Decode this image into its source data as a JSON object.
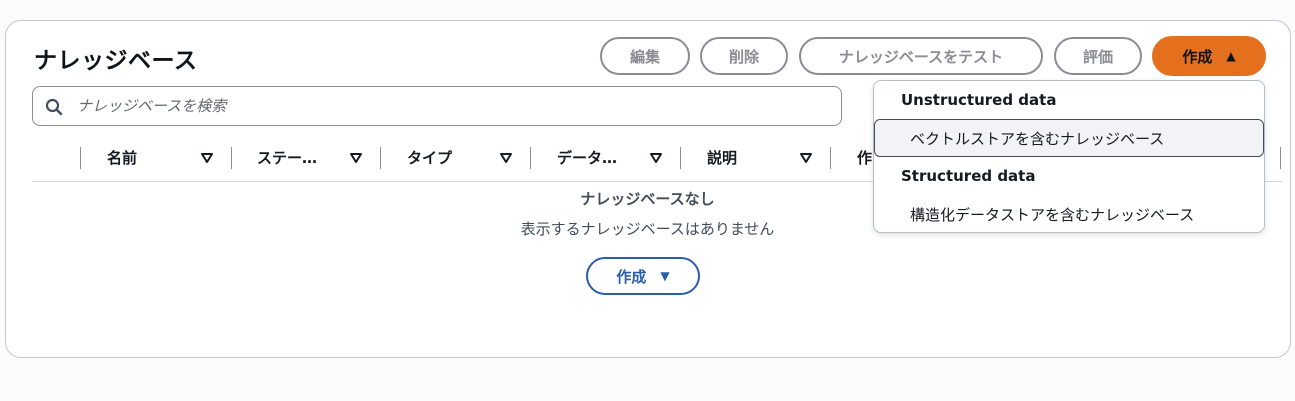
{
  "page": {
    "title": "ナレッジベース"
  },
  "toolbar": {
    "edit_label": "編集",
    "delete_label": "削除",
    "test_label": "ナレッジベースをテスト",
    "evaluate_label": "評価",
    "create_label": "作成",
    "create_caret": "▲"
  },
  "search": {
    "placeholder": "ナレッジベースを検索",
    "value": ""
  },
  "table": {
    "columns": [
      {
        "label": "名前"
      },
      {
        "label": "ステー…"
      },
      {
        "label": "タイプ"
      },
      {
        "label": "データ…"
      },
      {
        "label": "説明"
      },
      {
        "label": "作"
      }
    ],
    "rows": []
  },
  "empty_state": {
    "title": "ナレッジベースなし",
    "message": "表示するナレッジベースはありません",
    "create_label": "作成",
    "create_caret": "▼"
  },
  "create_menu": {
    "groups": [
      {
        "label": "Unstructured data",
        "items": [
          {
            "label": "ベクトルストアを含むナレッジベース",
            "highlighted": true
          }
        ]
      },
      {
        "label": "Structured data",
        "items": [
          {
            "label": "構造化データストアを含むナレッジベース",
            "highlighted": false
          }
        ]
      }
    ]
  },
  "colors": {
    "primary": "#e46f1d",
    "link": "#295eab",
    "disabled": "#8c8c94",
    "border": "#c6c6cd"
  }
}
